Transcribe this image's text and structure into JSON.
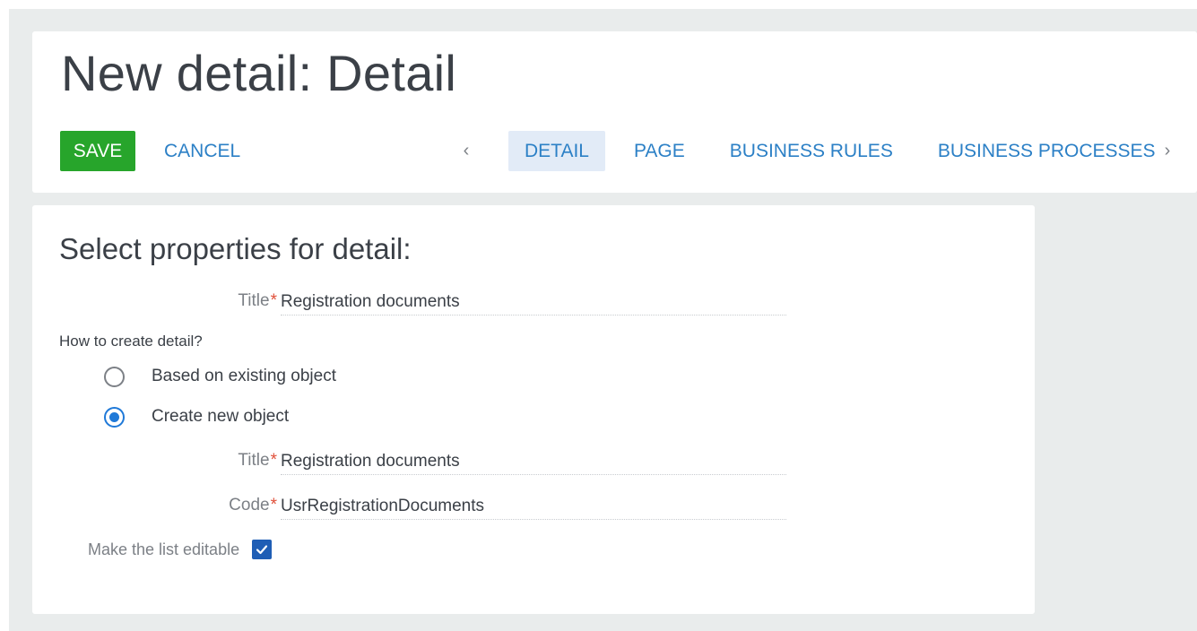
{
  "header": {
    "title": "New detail: Detail",
    "save_label": "SAVE",
    "cancel_label": "CANCEL",
    "prev_arrow": "‹",
    "next_arrow": "›",
    "tabs": [
      {
        "label": "DETAIL",
        "active": true
      },
      {
        "label": "PAGE",
        "active": false
      },
      {
        "label": "BUSINESS RULES",
        "active": false
      },
      {
        "label": "BUSINESS PROCESSES",
        "active": false
      }
    ]
  },
  "form": {
    "section_title": "Select properties for detail:",
    "detail_title": {
      "label": "Title",
      "required_mark": "*",
      "value": "Registration documents"
    },
    "question": "How to create detail?",
    "options": [
      {
        "label": "Based on existing object",
        "checked": false
      },
      {
        "label": "Create new object",
        "checked": true
      }
    ],
    "object_title": {
      "label": "Title",
      "required_mark": "*",
      "value": "Registration documents"
    },
    "object_code": {
      "label": "Code",
      "required_mark": "*",
      "value": "UsrRegistrationDocuments"
    },
    "editable": {
      "label": "Make the list editable",
      "checked": true
    }
  },
  "colors": {
    "save": "#27a52b",
    "link": "#2c80c6",
    "active_tab_bg": "#e2ebf7",
    "radio_checked": "#1f79d8",
    "checkbox": "#1f5eb5",
    "required": "#e0503a"
  }
}
